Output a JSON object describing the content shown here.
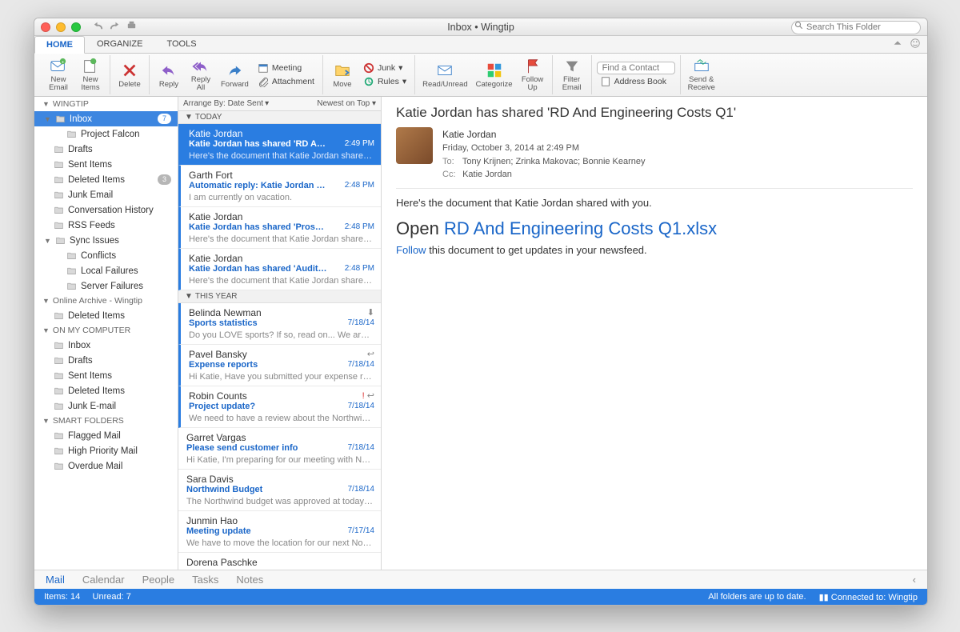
{
  "window": {
    "title": "Inbox • Wingtip"
  },
  "search": {
    "placeholder": "Search This Folder"
  },
  "tabs": [
    {
      "label": "HOME",
      "active": true
    },
    {
      "label": "ORGANIZE"
    },
    {
      "label": "TOOLS"
    }
  ],
  "ribbon": {
    "new_email": "New\nEmail",
    "new_items": "New\nItems",
    "delete": "Delete",
    "reply": "Reply",
    "reply_all": "Reply\nAll",
    "forward": "Forward",
    "meeting": "Meeting",
    "attachment": "Attachment",
    "move": "Move",
    "junk": "Junk",
    "rules": "Rules",
    "read_unread": "Read/Unread",
    "categorize": "Categorize",
    "follow_up": "Follow\nUp",
    "filter_email": "Filter\nEmail",
    "find_contact": "Find a Contact",
    "address_book": "Address Book",
    "send_receive": "Send &\nReceive"
  },
  "sidebar": {
    "accounts": [
      {
        "name": "WINGTIP",
        "folders": [
          {
            "label": "Inbox",
            "selected": true,
            "badge": "7",
            "children": [
              {
                "label": "Project Falcon"
              }
            ]
          },
          {
            "label": "Drafts"
          },
          {
            "label": "Sent Items"
          },
          {
            "label": "Deleted Items",
            "badge": "3"
          },
          {
            "label": "Junk Email"
          },
          {
            "label": "Conversation History"
          },
          {
            "label": "RSS Feeds"
          },
          {
            "label": "Sync Issues",
            "expanded": true,
            "children": [
              {
                "label": "Conflicts"
              },
              {
                "label": "Local Failures"
              },
              {
                "label": "Server Failures"
              }
            ]
          }
        ]
      },
      {
        "name": "Online Archive - Wingtip",
        "lower": true,
        "folders": [
          {
            "label": "Deleted Items"
          }
        ]
      },
      {
        "name": "ON MY COMPUTER",
        "folders": [
          {
            "label": "Inbox"
          },
          {
            "label": "Drafts"
          },
          {
            "label": "Sent Items"
          },
          {
            "label": "Deleted Items"
          },
          {
            "label": "Junk E-mail"
          }
        ]
      },
      {
        "name": "SMART FOLDERS",
        "folders": [
          {
            "label": "Flagged Mail"
          },
          {
            "label": "High Priority Mail"
          },
          {
            "label": "Overdue Mail"
          }
        ]
      }
    ]
  },
  "arrange": {
    "by": "Arrange By: Date Sent",
    "sort": "Newest on Top"
  },
  "groups": [
    {
      "label": "TODAY",
      "messages": [
        {
          "from": "Katie Jordan",
          "subject": "Katie Jordan has shared 'RD And Engineeri…",
          "preview": "Here's the document that Katie Jordan shared with you…",
          "date": "2:49 PM",
          "selected": true,
          "unread": true
        },
        {
          "from": "Garth Fort",
          "subject": "Automatic reply: Katie Jordan has shared '…",
          "preview": "I am currently on vacation.",
          "date": "2:48 PM",
          "unread": true
        },
        {
          "from": "Katie Jordan",
          "subject": "Katie Jordan has shared 'Proseware Projec…",
          "preview": "Here's the document that Katie Jordan shared with you…",
          "date": "2:48 PM",
          "unread": true
        },
        {
          "from": "Katie Jordan",
          "subject": "Katie Jordan has shared 'Audit of Small Bu…",
          "preview": "Here's the document that Katie Jordan shared with you…",
          "date": "2:48 PM",
          "unread": true
        }
      ]
    },
    {
      "label": "THIS YEAR",
      "messages": [
        {
          "from": "Belinda Newman",
          "subject": "Sports statistics",
          "preview": "Do you LOVE sports? If so, read on... We are going to…",
          "date": "7/18/14",
          "unread": true,
          "icon": "download"
        },
        {
          "from": "Pavel Bansky",
          "subject": "Expense reports",
          "preview": "Hi Katie, Have you submitted your expense reports yet…",
          "date": "7/18/14",
          "unread": true,
          "icon": "reply"
        },
        {
          "from": "Robin Counts",
          "subject": "Project update?",
          "preview": "We need to have a review about the Northwind Traders…",
          "date": "7/18/14",
          "unread": true,
          "icon": "flag-reply"
        },
        {
          "from": "Garret Vargas",
          "subject": "Please send customer info",
          "preview": "Hi Katie, I'm preparing for our meeting with Northwind,…",
          "date": "7/18/14"
        },
        {
          "from": "Sara Davis",
          "subject": "Northwind Budget",
          "preview": "The Northwind budget was approved at today's board…",
          "date": "7/18/14"
        },
        {
          "from": "Junmin Hao",
          "subject": "Meeting update",
          "preview": "We have to move the location for our next Northwind Tr…",
          "date": "7/17/14"
        },
        {
          "from": "Dorena Paschke",
          "subject": "",
          "preview": "",
          "date": ""
        }
      ]
    }
  ],
  "reading": {
    "title": "Katie Jordan has shared 'RD And Engineering Costs Q1'",
    "from": "Katie Jordan",
    "date": "Friday, October 3, 2014 at 2:49 PM",
    "to": "Tony Krijnen;   Zrinka Makovac;   Bonnie Kearney",
    "cc": "Katie Jordan",
    "line1": "Here's the document that Katie Jordan shared with you.",
    "open_prefix": "Open ",
    "open_link": "RD And Engineering Costs Q1.xlsx",
    "follow_link": "Follow",
    "follow_rest": " this document to get updates in your newsfeed."
  },
  "viewbar": [
    "Mail",
    "Calendar",
    "People",
    "Tasks",
    "Notes"
  ],
  "status": {
    "left": "Items: 14     Unread: 7",
    "right1": "All folders are up to date.",
    "right2": "Connected to: Wingtip"
  }
}
